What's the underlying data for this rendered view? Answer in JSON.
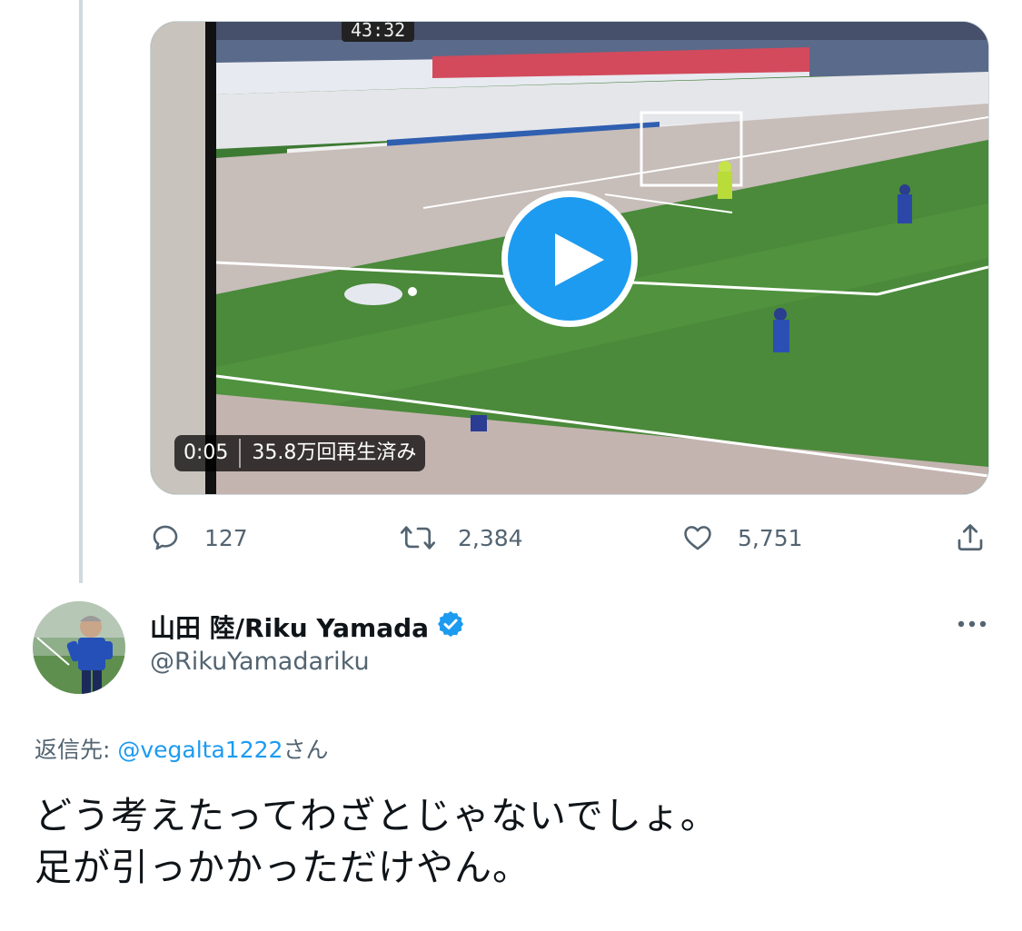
{
  "video": {
    "duration": "0:05",
    "views": "35.8万回再生済み",
    "scoreboard_clock": "43:32",
    "play_icon": "play-icon"
  },
  "actions": {
    "reply_count": "127",
    "retweet_count": "2,384",
    "like_count": "5,751",
    "icons": [
      "reply-icon",
      "retweet-icon",
      "like-icon",
      "share-icon"
    ]
  },
  "reply_tweet": {
    "display_name": "山田 陸/Riku Yamada",
    "handle": "@RikuYamadariku",
    "reply_prefix": "返信先: ",
    "reply_mention": "@vegalta1222",
    "reply_suffix": "さん",
    "text_line1": "どう考えたってわざとじゃないでしょ。",
    "text_line2": "足が引っかかっただけやん。"
  },
  "colors": {
    "accent": "#1d9bf0",
    "secondary_text": "#536471",
    "primary_text": "#0f1419",
    "thread_line": "#cfd9de"
  }
}
